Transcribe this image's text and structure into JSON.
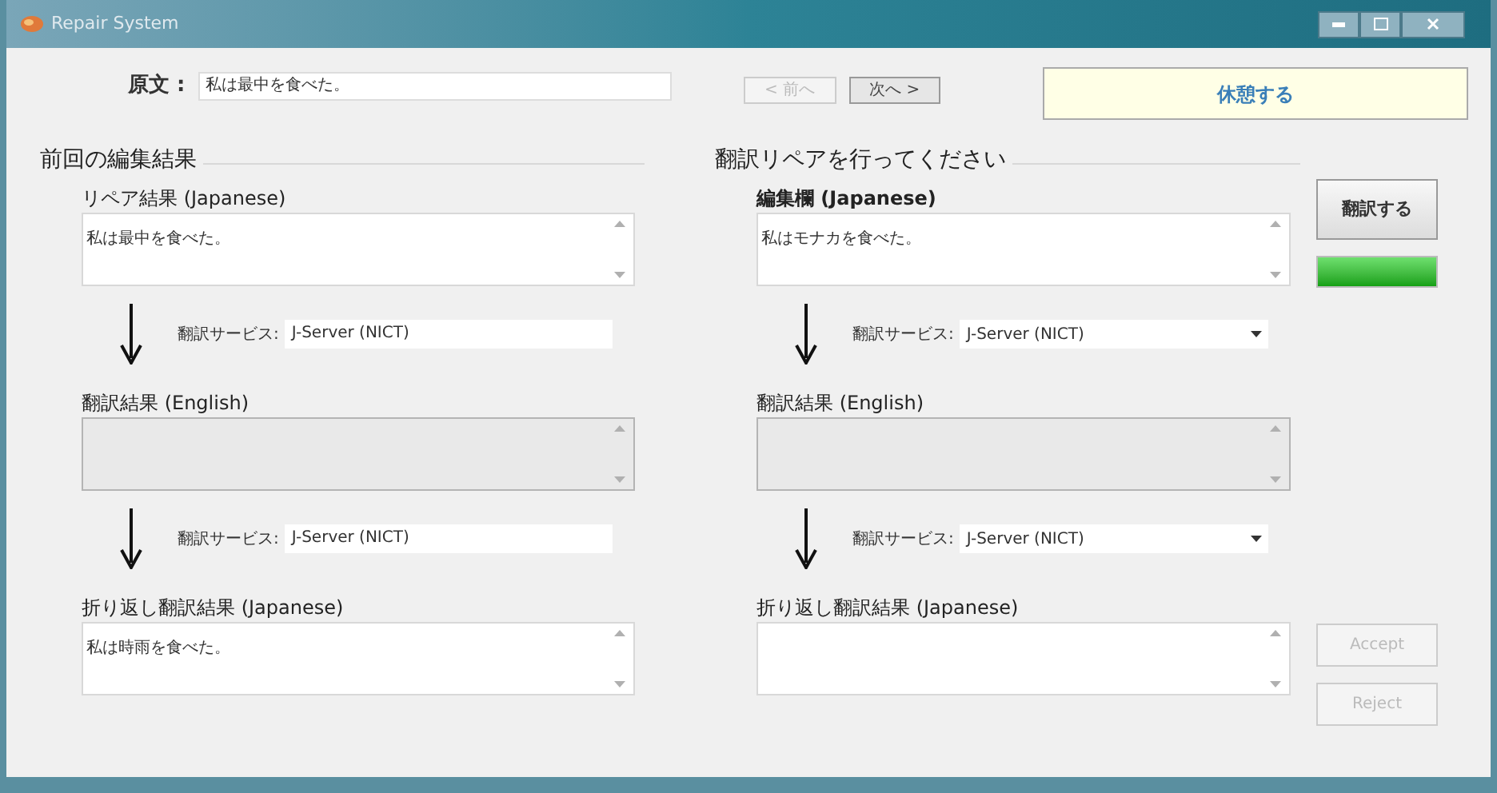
{
  "window": {
    "title": "Repair System"
  },
  "source": {
    "label": "原文 :",
    "value": "私は最中を食べた。"
  },
  "nav_buttons": [
    {
      "label": "< 前へ",
      "disabled": true
    },
    {
      "label": "次へ >",
      "disabled": false
    }
  ],
  "break_button": {
    "label": "休憩する"
  },
  "panels": [
    {
      "title": "前回の編集結果",
      "items": [
        {
          "kind": "result",
          "label": "リペア結果 (Japanese)",
          "bold": false,
          "value": "私は最中を食べた。",
          "disabled": false
        },
        {
          "kind": "service",
          "label": "翻訳サービス:",
          "value": "J-Server (NICT)",
          "dropdown": false
        },
        {
          "kind": "result",
          "label": "翻訳結果 (English)",
          "bold": false,
          "disabled": true
        },
        {
          "kind": "service",
          "label": "翻訳サービス:",
          "value": "J-Server (NICT)",
          "dropdown": false
        },
        {
          "kind": "result",
          "label": "折り返し翻訳結果 (Japanese)",
          "bold": false,
          "value": "私は時雨を食べた。",
          "disabled": false
        }
      ]
    },
    {
      "title": "翻訳リペアを行ってください",
      "items": [
        {
          "kind": "result",
          "label": "編集欄 (Japanese)",
          "bold": true,
          "value": "私はモナカを食べた。",
          "disabled": false
        },
        {
          "kind": "service",
          "label": "翻訳サービス:",
          "value": "J-Server (NICT)",
          "dropdown": true
        },
        {
          "kind": "result",
          "label": "翻訳結果 (English)",
          "bold": false,
          "disabled": true
        },
        {
          "kind": "service",
          "label": "翻訳サービス:",
          "value": "J-Server (NICT)",
          "dropdown": true
        },
        {
          "kind": "result",
          "label": "折り返し翻訳結果 (Japanese)",
          "bold": false,
          "disabled": false
        }
      ]
    }
  ],
  "translate_button": {
    "label": "翻訳する"
  },
  "progress": {
    "level": 1
  },
  "decision_buttons": [
    {
      "label": "Accept",
      "disabled": true
    },
    {
      "label": "Reject",
      "disabled": true
    }
  ]
}
